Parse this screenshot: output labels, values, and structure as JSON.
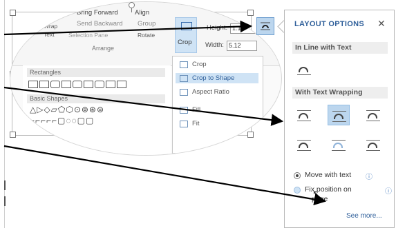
{
  "ribbon": {
    "bring_forward": "Bring Forward",
    "send_backward": "Send Backward",
    "align": "Align",
    "group": "Group",
    "rotate": "Rotate",
    "selection_pane": "Selection Pane",
    "wrap_line1": "Wrap",
    "wrap_line2": "Text",
    "arrange_group": "Arrange",
    "crop_label": "Crop",
    "height_label": "Height:",
    "height_value": "1.1",
    "width_label": "Width:",
    "width_value": "5.12"
  },
  "crop_menu": {
    "items": [
      "Crop",
      "Crop to Shape",
      "Aspect Ratio",
      "Fill",
      "Fit"
    ]
  },
  "shapes": {
    "section_rectangles": "Rectangles",
    "section_basic": "Basic Shapes",
    "basic_row1": "△▷◇▱⬠⬡⊙⊚⊛⊜",
    "basic_row2": "⌐⌐⌐⌐⌐▢◌◌▢▢"
  },
  "panel": {
    "title": "LAYOUT OPTIONS",
    "close": "✕",
    "section_inline": "In Line with Text",
    "section_wrap": "With Text Wrapping",
    "move_with_text": "Move with text",
    "fix_position_line1": "Fix position on",
    "fix_position_line2": "page",
    "info_glyph": "ⓘ",
    "see_more": "See more..."
  },
  "colors": {
    "accent": "#2f5f9a",
    "selected_tile": "#bcd6ee",
    "arrow": "#000000"
  }
}
